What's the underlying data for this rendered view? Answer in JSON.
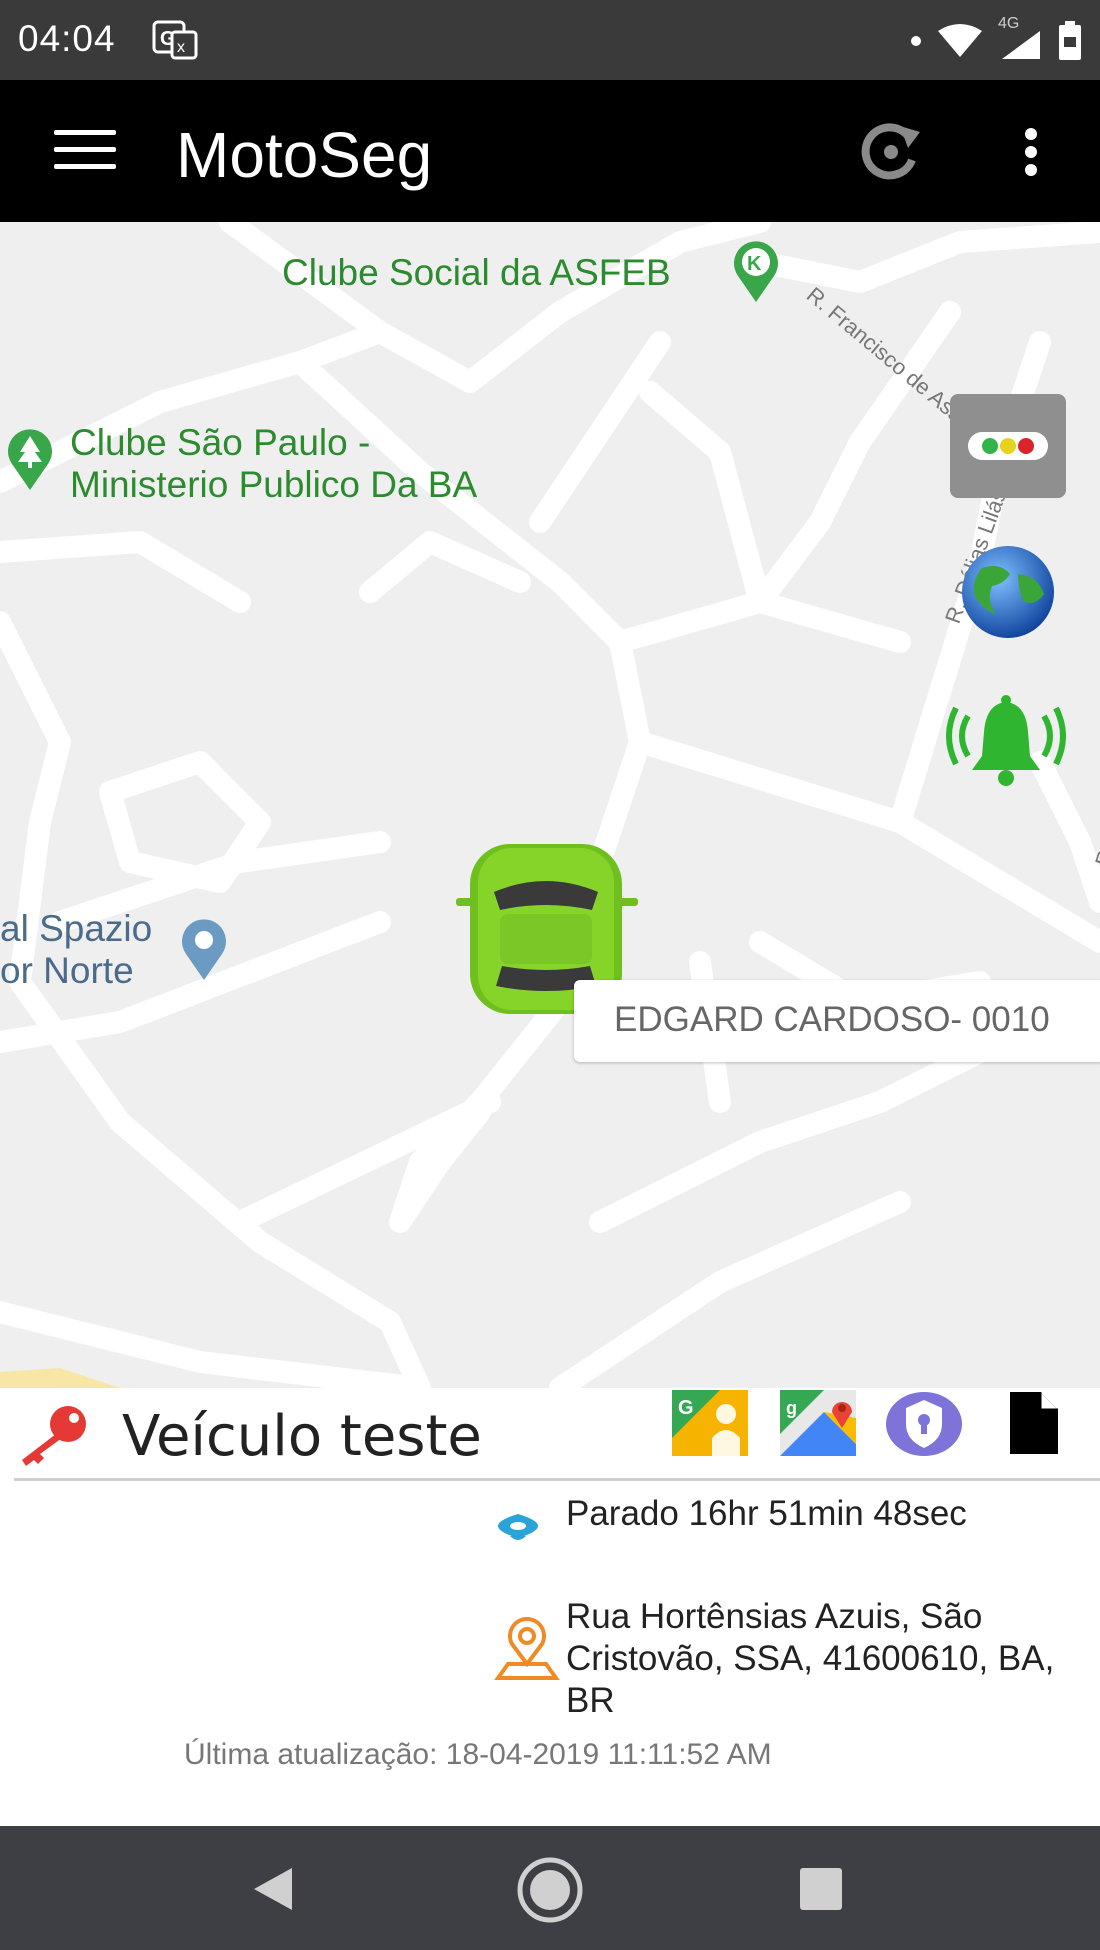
{
  "status_bar": {
    "time": "04:04",
    "network": "4G"
  },
  "app_bar": {
    "title": "MotoSeg"
  },
  "map": {
    "pois": [
      {
        "name": "Clube Social da ASFEB"
      },
      {
        "line1": "Clube São Paulo -",
        "line2": "Ministerio Publico Da BA"
      },
      {
        "line1": "al Spazio",
        "line2": "or Norte"
      }
    ],
    "streets": [
      "R. Francisco de Assis",
      "R. Dálias Lilás",
      "R. Bromélias Brancas"
    ],
    "vehicle_marker_label": "EDGARD CARDOSO- 0010"
  },
  "panel": {
    "vehicle_name": "Veículo teste",
    "status": "Parado 16hr 51min 48sec",
    "address": "Rua Hortênsias Azuis, São Cristovão, SSA, 41600610, BA, BR",
    "last_update": "Última atualização: 18-04-2019 11:11:52 AM"
  },
  "colors": {
    "accent_green": "#2fb52f",
    "key_red": "#e53935",
    "status_bar": "#3a3a3a",
    "app_bar": "#000000"
  }
}
